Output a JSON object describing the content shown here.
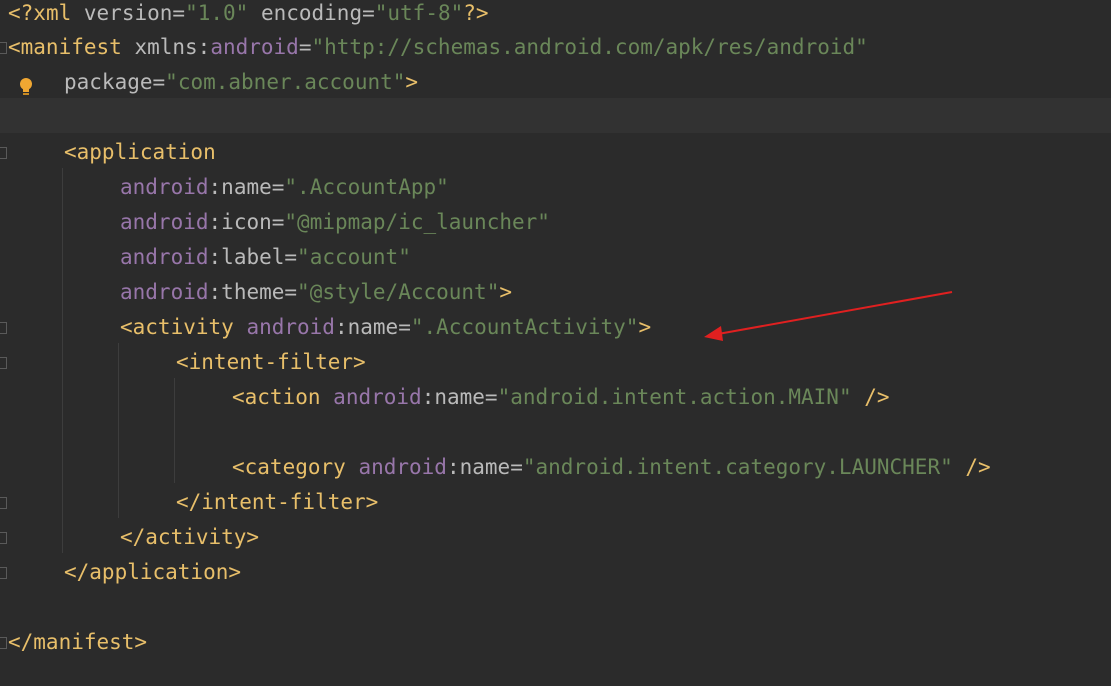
{
  "editor": {
    "lines": {
      "l1": {
        "open": "<?",
        "kw": "xml",
        "a1": "version",
        "v1": "\"1.0\"",
        "a2": "encoding",
        "v2": "\"utf-8\"",
        "close": "?>"
      },
      "l2": {
        "tag": "<manifest",
        "attr": "xmlns",
        "ns": "android",
        "val": "\"http://schemas.android.com/apk/res/android\""
      },
      "l3": {
        "attr": "package",
        "val": "\"com.abner.account\"",
        "close": ">"
      },
      "l5": {
        "tag": "<application"
      },
      "l6": {
        "ns": "android",
        "attr": "name",
        "val": "\".AccountApp\""
      },
      "l7": {
        "ns": "android",
        "attr": "icon",
        "val": "\"@mipmap/ic_launcher\""
      },
      "l8": {
        "ns": "android",
        "attr": "label",
        "val": "\"account\""
      },
      "l9": {
        "ns": "android",
        "attr": "theme",
        "val": "\"@style/Account\"",
        "close": ">"
      },
      "l10": {
        "tag": "<activity",
        "ns": "android",
        "attr": "name",
        "val": "\".AccountActivity\"",
        "close": ">"
      },
      "l11": {
        "tag": "<intent-filter>"
      },
      "l12": {
        "tag": "<action",
        "ns": "android",
        "attr": "name",
        "val": "\"android.intent.action.MAIN\"",
        "close": "/>"
      },
      "l14": {
        "tag": "<category",
        "ns": "android",
        "attr": "name",
        "val": "\"android.intent.category.LAUNCHER\"",
        "close": "/>"
      },
      "l15": {
        "tag": "</intent-filter>"
      },
      "l16": {
        "tag": "</activity>"
      },
      "l17": {
        "tag": "</application>"
      },
      "l19": {
        "tag": "</manifest>"
      }
    },
    "colon": ":",
    "equals": "=",
    "space": " "
  },
  "colors": {
    "background": "#2b2b2b",
    "tag": "#e8bf6a",
    "namespace": "#9876aa",
    "value": "#6a8759",
    "annotation_arrow": "#e02020",
    "bulb": "#f0a732"
  },
  "icons": {
    "gutter_bulb": "lightbulb-icon",
    "fold_markers": "fold-marker-icon",
    "annotation": "red-arrow"
  }
}
